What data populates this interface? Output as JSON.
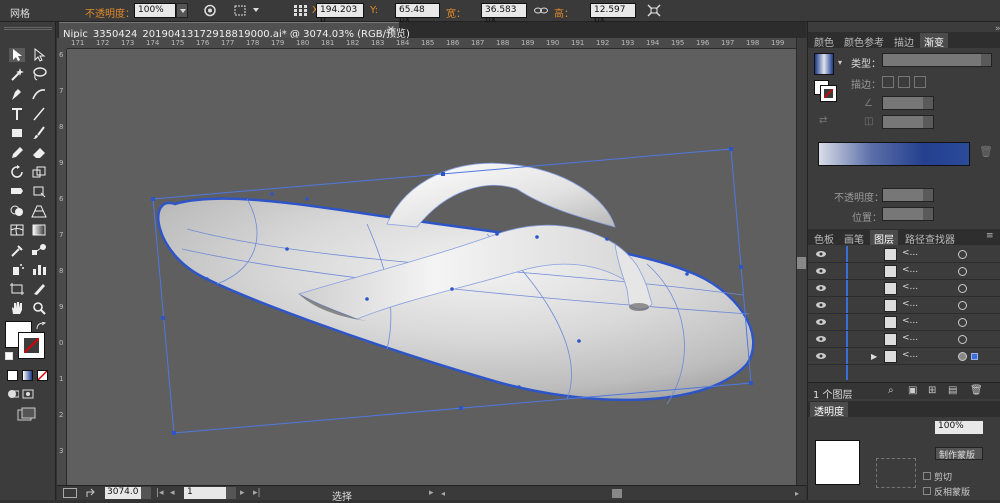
{
  "control_bar": {
    "mode_label": "网格",
    "opacity_label": "不透明度：",
    "opacity_value": "100%",
    "x_label": "X:",
    "x_value": "194.203 p",
    "y_label": "Y:",
    "y_value": "65.48 px",
    "w_label": "宽：",
    "w_value": "36.583 px",
    "h_label": "高：",
    "h_value": "12.597 px"
  },
  "document": {
    "tab_title": "Nipic_3350424_20190413172918819000.ai* @ 3074.03% (RGB/预览)",
    "close": "×"
  },
  "rulers": {
    "top_ticks": [
      "171",
      "172",
      "173",
      "174",
      "175",
      "176",
      "177",
      "178",
      "179",
      "180",
      "181",
      "182",
      "183",
      "184",
      "185",
      "186",
      "187",
      "188",
      "189",
      "190",
      "191",
      "192",
      "193",
      "194",
      "195",
      "196",
      "197",
      "198",
      "199"
    ],
    "left_ticks": [
      "6",
      "7",
      "8",
      "9",
      "6",
      "7",
      "8",
      "9",
      "0",
      "1",
      "2",
      "3"
    ]
  },
  "status": {
    "zoom": "3074.0",
    "artboard": "1",
    "tool": "选择"
  },
  "panels": {
    "top_tabs": [
      "颜色",
      "颜色参考",
      "描边",
      "渐变"
    ],
    "gradient": {
      "type_label": "类型：",
      "stroke_label": "描边：",
      "opacity_label": "不透明度：",
      "position_label": "位置："
    },
    "layer_tabs": [
      "色板",
      "画笔",
      "图层",
      "路径查找器"
    ],
    "layer_rows": [
      "<...",
      "<...",
      "<...",
      "<...",
      "<...",
      "<...",
      "<..."
    ],
    "layer_count": "1 个图层",
    "transparency_tab": "透明度",
    "transparency_value": "100%",
    "mask_button": "制作蒙版",
    "clip_label": "剪切",
    "invert_label": "反相蒙版"
  },
  "colors": {
    "accent_blue": "#3b6fd6",
    "gradient_start": "#d9dce8",
    "gradient_end": "#2a4a9a"
  }
}
